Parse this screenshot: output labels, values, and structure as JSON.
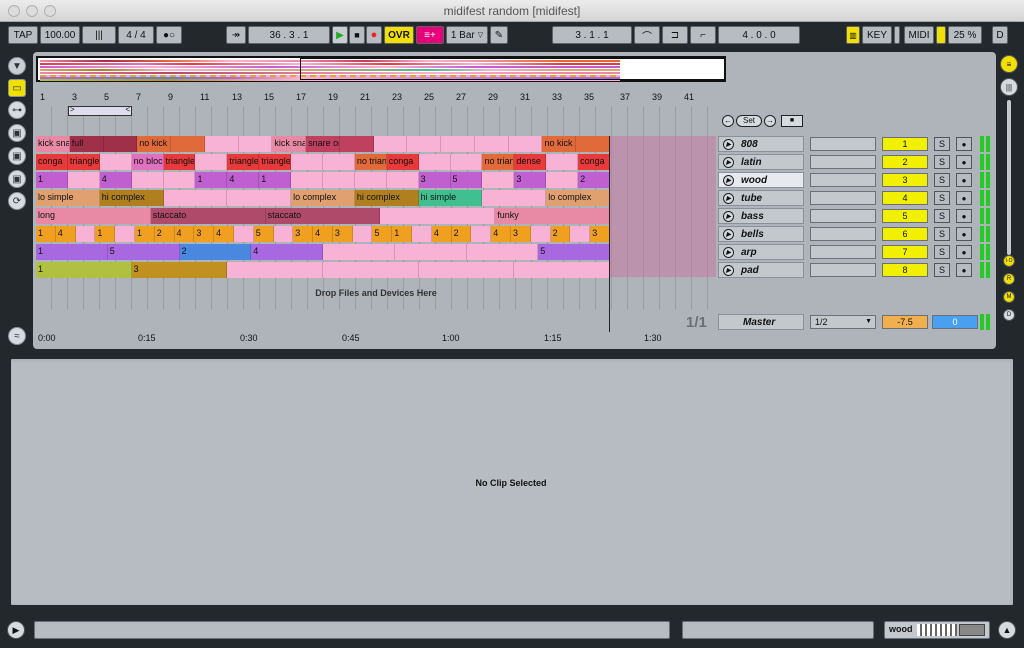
{
  "window": {
    "title": "midifest random  [midifest]"
  },
  "control_bar": {
    "tap": "TAP",
    "tempo": "100.00",
    "tempo_nudge": "|||",
    "time_signature": "4 / 4",
    "metronome": "●○",
    "follow": "↠",
    "position": "36 . 3 . 1",
    "ovr": "OVR",
    "quantize": "1 Bar",
    "loop_start": "3 . 1 . 1",
    "loop_length": "4 . 0 . 0",
    "key": "KEY",
    "midi": "MIDI",
    "cpu": "25 %",
    "disk": "D"
  },
  "ruler": {
    "bars": [
      "1",
      "3",
      "5",
      "7",
      "9",
      "11",
      "13",
      "15",
      "17",
      "19",
      "21",
      "23",
      "25",
      "27",
      "29",
      "31",
      "33",
      "35",
      "37",
      "39",
      "41"
    ]
  },
  "timeline": {
    "marks": [
      "0:00",
      "0:15",
      "0:30",
      "0:45",
      "1:00",
      "1:15",
      "1:30"
    ]
  },
  "fraction": "1/1",
  "drop_zone": "Drop Files and Devices Here",
  "tracks": [
    {
      "name": "808",
      "number": "1",
      "clips": [
        {
          "label": "kick snare",
          "color": "#e88aa6"
        },
        {
          "label": "full",
          "color": "#a0304a"
        },
        {
          "label": "",
          "color": "#a0304a"
        },
        {
          "label": "no kick",
          "color": "#e06a3a"
        },
        {
          "label": "",
          "color": "#e06a3a"
        },
        {
          "label": "",
          "color": "#f7b2d6"
        },
        {
          "label": "",
          "color": "#f7b2d6"
        },
        {
          "label": "kick snare",
          "color": "#e88aa6"
        },
        {
          "label": "snare only",
          "color": "#c04060"
        },
        {
          "label": "",
          "color": "#c04060"
        },
        {
          "label": "",
          "color": "#f7b2d6"
        },
        {
          "label": "",
          "color": "#f7b2d6"
        },
        {
          "label": "",
          "color": "#f7b2d6"
        },
        {
          "label": "",
          "color": "#f7b2d6"
        },
        {
          "label": "",
          "color": "#f7b2d6"
        },
        {
          "label": "no kick",
          "color": "#e06a3a"
        },
        {
          "label": "",
          "color": "#e06a3a"
        }
      ]
    },
    {
      "name": "latin",
      "number": "2",
      "clips": [
        {
          "label": "conga",
          "color": "#e83a3a"
        },
        {
          "label": "triangle",
          "color": "#e83a3a"
        },
        {
          "label": "",
          "color": "#f7b2d6"
        },
        {
          "label": "no block",
          "color": "#e070c0"
        },
        {
          "label": "triangle",
          "color": "#e83a3a"
        },
        {
          "label": "",
          "color": "#f7b2d6"
        },
        {
          "label": "triangle",
          "color": "#e83a3a"
        },
        {
          "label": "triangle",
          "color": "#e83a3a"
        },
        {
          "label": "",
          "color": "#f7b2d6"
        },
        {
          "label": "",
          "color": "#f7b2d6"
        },
        {
          "label": "no triangle",
          "color": "#e06a3a"
        },
        {
          "label": "conga",
          "color": "#e83a3a"
        },
        {
          "label": "",
          "color": "#f7b2d6"
        },
        {
          "label": "",
          "color": "#f7b2d6"
        },
        {
          "label": "no triangle",
          "color": "#e06a3a"
        },
        {
          "label": "dense",
          "color": "#e83a3a"
        },
        {
          "label": "",
          "color": "#f7b2d6"
        },
        {
          "label": "conga",
          "color": "#e83a3a"
        }
      ]
    },
    {
      "name": "wood",
      "number": "3",
      "clips": [
        {
          "label": "1",
          "color": "#c060d0"
        },
        {
          "label": "",
          "color": "#f7b2d6"
        },
        {
          "label": "4",
          "color": "#c060d0"
        },
        {
          "label": "",
          "color": "#f7b2d6"
        },
        {
          "label": "",
          "color": "#f7b2d6"
        },
        {
          "label": "1",
          "color": "#c060d0"
        },
        {
          "label": "4",
          "color": "#c060d0"
        },
        {
          "label": "1",
          "color": "#c060d0"
        },
        {
          "label": "",
          "color": "#f7b2d6"
        },
        {
          "label": "",
          "color": "#f7b2d6"
        },
        {
          "label": "",
          "color": "#f7b2d6"
        },
        {
          "label": "",
          "color": "#f7b2d6"
        },
        {
          "label": "3",
          "color": "#c060d0"
        },
        {
          "label": "5",
          "color": "#c060d0"
        },
        {
          "label": "",
          "color": "#f7b2d6"
        },
        {
          "label": "3",
          "color": "#c060d0"
        },
        {
          "label": "",
          "color": "#f7b2d6"
        },
        {
          "label": "2",
          "color": "#c060d0"
        }
      ]
    },
    {
      "name": "tube",
      "number": "4",
      "clips": [
        {
          "label": "lo simple",
          "color": "#e0a070"
        },
        {
          "label": "hi complex",
          "color": "#b08020"
        },
        {
          "label": "",
          "color": "#f7b2d6"
        },
        {
          "label": "",
          "color": "#f7b2d6"
        },
        {
          "label": "lo complex",
          "color": "#e0a070"
        },
        {
          "label": "hi complex",
          "color": "#b08020"
        },
        {
          "label": "hi simple",
          "color": "#40c090"
        },
        {
          "label": "",
          "color": "#f7b2d6"
        },
        {
          "label": "lo complex",
          "color": "#e0a070"
        }
      ]
    },
    {
      "name": "bass",
      "number": "5",
      "clips": [
        {
          "label": "long",
          "color": "#e88aa6"
        },
        {
          "label": "staccato",
          "color": "#b04a6a"
        },
        {
          "label": "staccato",
          "color": "#b04a6a"
        },
        {
          "label": "",
          "color": "#f7b2d6"
        },
        {
          "label": "funky",
          "color": "#e88aa6"
        }
      ]
    },
    {
      "name": "bells",
      "number": "6",
      "clips": [
        {
          "label": "1",
          "color": "#f0a020"
        },
        {
          "label": "4",
          "color": "#f0a020"
        },
        {
          "label": "",
          "color": "#f7b2d6"
        },
        {
          "label": "1",
          "color": "#f0a020"
        },
        {
          "label": "",
          "color": "#f7b2d6"
        },
        {
          "label": "1",
          "color": "#f0a020"
        },
        {
          "label": "2",
          "color": "#f0a020"
        },
        {
          "label": "4",
          "color": "#f0a020"
        },
        {
          "label": "3",
          "color": "#f0a020"
        },
        {
          "label": "4",
          "color": "#f0a020"
        },
        {
          "label": "",
          "color": "#f7b2d6"
        },
        {
          "label": "5",
          "color": "#f0a020"
        },
        {
          "label": "",
          "color": "#f7b2d6"
        },
        {
          "label": "3",
          "color": "#f0a020"
        },
        {
          "label": "4",
          "color": "#f0a020"
        },
        {
          "label": "3",
          "color": "#f0a020"
        },
        {
          "label": "",
          "color": "#f7b2d6"
        },
        {
          "label": "5",
          "color": "#f0a020"
        },
        {
          "label": "1",
          "color": "#f0a020"
        },
        {
          "label": "",
          "color": "#f7b2d6"
        },
        {
          "label": "4",
          "color": "#f0a020"
        },
        {
          "label": "2",
          "color": "#f0a020"
        },
        {
          "label": "",
          "color": "#f7b2d6"
        },
        {
          "label": "4",
          "color": "#f0a020"
        },
        {
          "label": "3",
          "color": "#f0a020"
        },
        {
          "label": "",
          "color": "#f7b2d6"
        },
        {
          "label": "2",
          "color": "#f0a020"
        },
        {
          "label": "",
          "color": "#f7b2d6"
        },
        {
          "label": "3",
          "color": "#f0a020"
        }
      ]
    },
    {
      "name": "arp",
      "number": "7",
      "clips": [
        {
          "label": "1",
          "color": "#a868e0"
        },
        {
          "label": "5",
          "color": "#a868e0"
        },
        {
          "label": "2",
          "color": "#4a88e0"
        },
        {
          "label": "4",
          "color": "#a868e0"
        },
        {
          "label": "",
          "color": "#f7b2d6"
        },
        {
          "label": "",
          "color": "#f7b2d6"
        },
        {
          "label": "",
          "color": "#f7b2d6"
        },
        {
          "label": "5",
          "color": "#a868e0"
        }
      ]
    },
    {
      "name": "pad",
      "number": "8",
      "clips": [
        {
          "label": "1",
          "color": "#b0c040"
        },
        {
          "label": "3",
          "color": "#c09020"
        },
        {
          "label": "",
          "color": "#f7b2d6"
        },
        {
          "label": "",
          "color": "#f7b2d6"
        },
        {
          "label": "",
          "color": "#f7b2d6"
        },
        {
          "label": "",
          "color": "#f7b2d6"
        }
      ]
    }
  ],
  "master": {
    "name": "Master",
    "routing": "1/2",
    "volume": "-7.5",
    "pan": "0"
  },
  "track_buttons": {
    "solo": "S",
    "arm": "●"
  },
  "loop_controls": {
    "set": "Set"
  },
  "detail": {
    "empty_text": "No Clip Selected"
  },
  "status_bar": {
    "selected_track": "wood"
  },
  "right_strip": {
    "io": "I·O",
    "r": "R",
    "m": "M",
    "d": "D"
  }
}
